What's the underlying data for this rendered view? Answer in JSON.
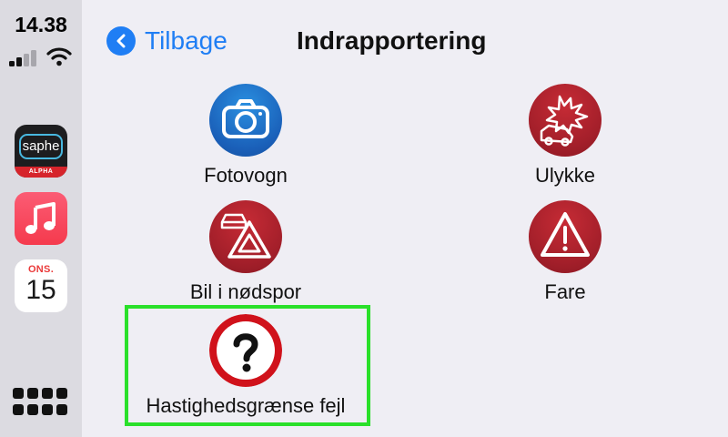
{
  "status": {
    "time": "14.38"
  },
  "dock": {
    "apps": [
      {
        "name": "saphe",
        "logo_text": "saphe",
        "badge": "ALPHA"
      },
      {
        "name": "music"
      },
      {
        "name": "calendar",
        "day": "ONS.",
        "date": "15"
      }
    ]
  },
  "header": {
    "back_label": "Tilbage",
    "title": "Indrapportering"
  },
  "items": [
    {
      "label": "Fotovogn",
      "icon": "camera-icon",
      "color": "#1a5fb8"
    },
    {
      "label": "Ulykke",
      "icon": "car-crash-icon",
      "color": "#a31f2a"
    },
    {
      "label": "Bil i nødspor",
      "icon": "breakdown-triangle-icon",
      "color": "#a31f2a"
    },
    {
      "label": "Fare",
      "icon": "warning-icon",
      "color": "#a31f2a"
    },
    {
      "label": "Hastighedsgrænse fejl",
      "icon": "question-sign-icon",
      "color": "#d0121b"
    }
  ],
  "colors": {
    "accent": "#1f7ef4",
    "selection": "#2ae02a"
  }
}
